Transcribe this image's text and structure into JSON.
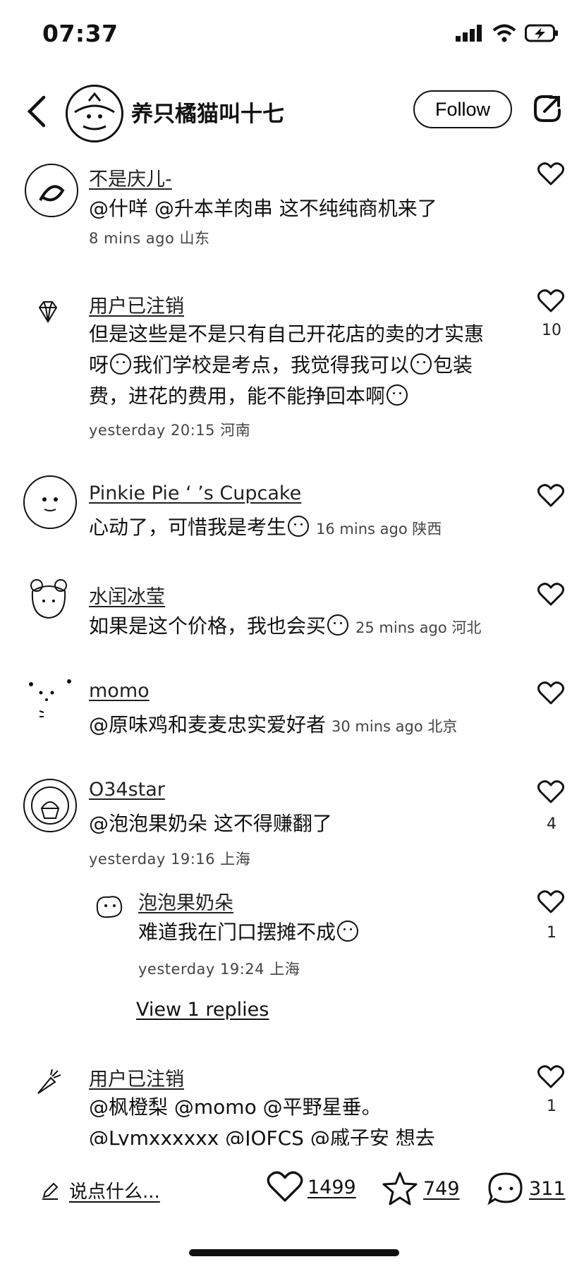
{
  "status_bar": {
    "time": "07:37"
  },
  "header": {
    "author_name": "养只橘猫叫十七",
    "follow_label": "Follow"
  },
  "comments": [
    {
      "user": "不是庆儿-",
      "text": "@什咩 @升本羊肉串 这不纯纯商机来了",
      "meta": "8 mins ago 山东",
      "likes": ""
    },
    {
      "user": "用户已注销",
      "text": "但是这些是不是只有自己开花店的卖的才实惠呀",
      "text2": "我们学校是考点，我觉得我可以",
      "text3": "包装费，进花的费用，能不能挣回本啊",
      "meta": "yesterday 20:15 河南",
      "likes": "10"
    },
    {
      "user": "Pinkie Pie ‘ ’s Cupcake",
      "text": "心动了，可惜我是考生",
      "meta": "16 mins ago 陕西",
      "likes": ""
    },
    {
      "user": "水闰冰莹",
      "text": "如果是这个价格，我也会买",
      "meta": "25 mins ago 河北",
      "likes": ""
    },
    {
      "user": "momo",
      "text": "@原味鸡和麦麦忠实爱好者",
      "meta": "30 mins ago 北京",
      "likes": ""
    },
    {
      "user": "O34star",
      "text": "@泡泡果奶朵 这不得赚翻了",
      "meta": "yesterday 19:16 上海",
      "likes": "4"
    },
    {
      "user": "泡泡果奶朵",
      "text": "难道我在门口摆摊不成",
      "meta": "yesterday 19:24 上海",
      "likes": "1"
    },
    {
      "user": "用户已注销",
      "text": "@枫橙梨 @momo @平野星垂。",
      "text2": "@Lymxxxxxx @JOFCS @戚子安 想去",
      "meta": "",
      "likes": "1"
    }
  ],
  "view_replies": "View 1 replies",
  "bottom_bar": {
    "placeholder": "说点什么...",
    "likes": "1499",
    "favorites": "749",
    "comments": "311"
  }
}
